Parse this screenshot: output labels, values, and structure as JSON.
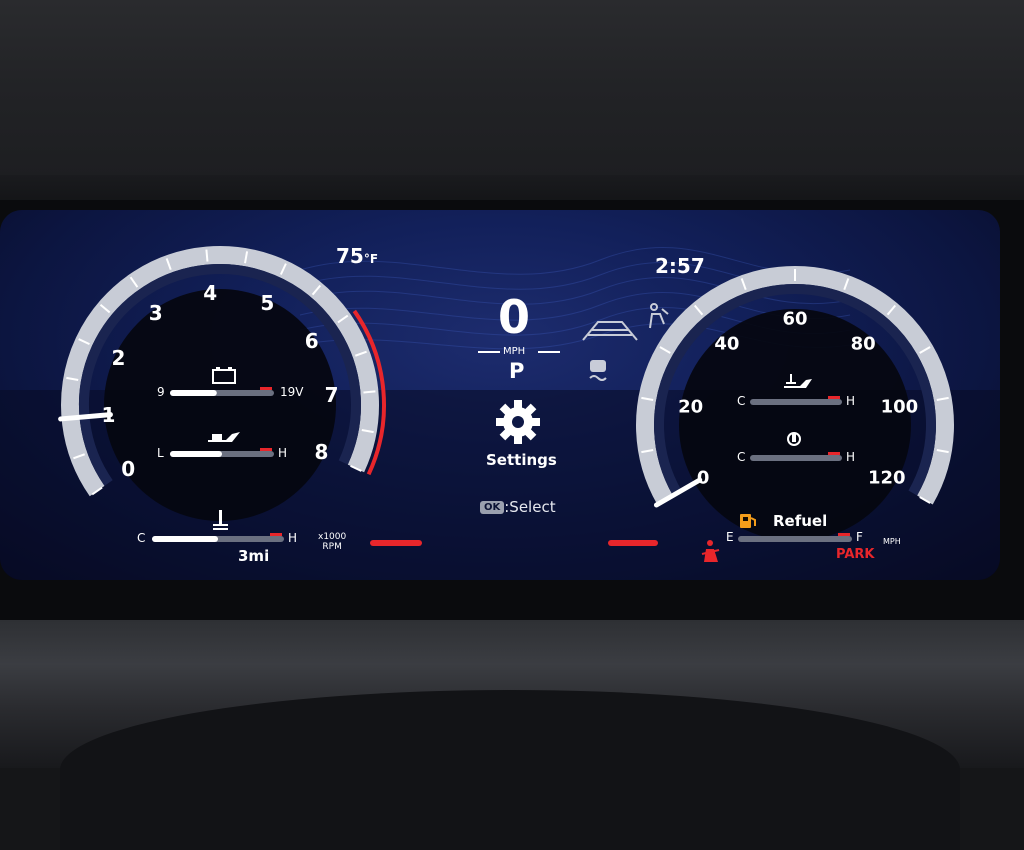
{
  "status": {
    "temperature": "75",
    "temp_unit": "°F",
    "clock": "2:57"
  },
  "speed": {
    "value": "0",
    "unit": "MPH",
    "gear": "P"
  },
  "menu": {
    "settings_label": "Settings",
    "ok_key": "OK",
    "select_hint": ":Select"
  },
  "tachometer": {
    "ticks": [
      "0",
      "1",
      "2",
      "3",
      "4",
      "5",
      "6",
      "7",
      "8"
    ],
    "unit_line1": "x1000",
    "unit_line2": "RPM",
    "rpm_value": 1.0,
    "redline_from": 6.0
  },
  "speedometer": {
    "ticks": [
      "0",
      "20",
      "40",
      "60",
      "80",
      "100",
      "120"
    ],
    "unit": "MPH",
    "speed_value": 0
  },
  "left_gauges": {
    "battery": {
      "min": "9",
      "max": "19V",
      "fill": 0.45
    },
    "oil_pressure": {
      "min": "L",
      "max": "H",
      "fill": 0.5
    },
    "coolant_temp": {
      "min": "C",
      "max": "H",
      "fill": 0.5
    }
  },
  "right_gauges": {
    "oil_temp": {
      "min": "C",
      "max": "H",
      "fill": 0.0
    },
    "transmission_temp": {
      "min": "C",
      "max": "H",
      "fill": 0.0
    },
    "fuel": {
      "min": "E",
      "max": "F",
      "fill": 0.0,
      "warning": "Refuel"
    }
  },
  "odometer": {
    "range": "3mi"
  },
  "indicators": {
    "park": "PARK"
  },
  "colors": {
    "accent_red": "#e8262b",
    "gauge_white": "#ffffff",
    "bg_blue": "#12205a"
  }
}
